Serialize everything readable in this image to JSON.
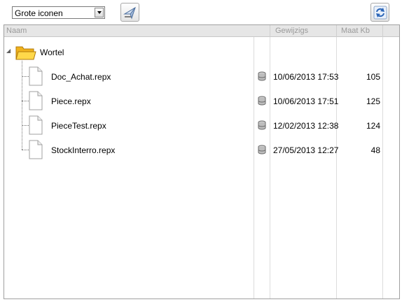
{
  "toolbar": {
    "view_select_value": "Grote iconen",
    "open_icon": "open-arrow-icon",
    "refresh_icon": "refresh-icon"
  },
  "columns": {
    "name": "Naam",
    "modified": "Gewijzigs",
    "size": "Maat Kb"
  },
  "tree": {
    "root_label": "Wortel",
    "files": [
      {
        "name": "Doc_Achat.repx",
        "modified": "10/06/2013 17:53",
        "size": "105"
      },
      {
        "name": "Piece.repx",
        "modified": "10/06/2013 17:51",
        "size": "125"
      },
      {
        "name": "PieceTest.repx",
        "modified": "12/02/2013 12:38",
        "size": "124"
      },
      {
        "name": "StockInterro.repx",
        "modified": "27/05/2013 12:27",
        "size": "48"
      }
    ]
  }
}
